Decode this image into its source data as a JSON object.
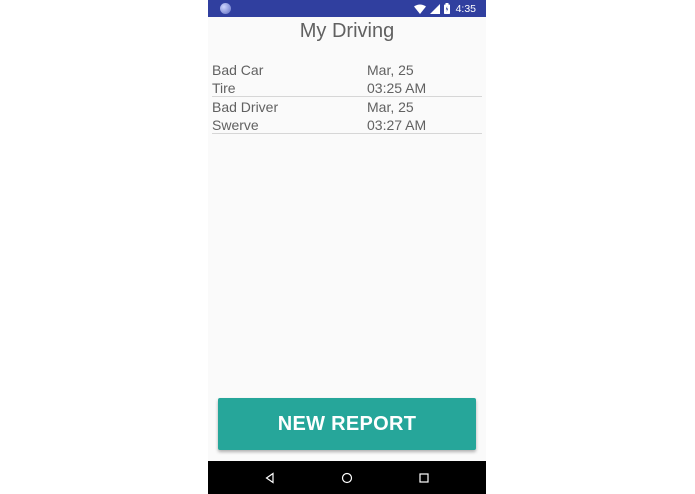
{
  "status_bar": {
    "time": "4:35"
  },
  "header": {
    "title": "My Driving"
  },
  "reports": [
    {
      "type": "Bad Car",
      "subtype": "Tire",
      "date": "Mar, 25",
      "time": "03:25 AM"
    },
    {
      "type": "Bad Driver",
      "subtype": "Swerve",
      "date": "Mar, 25",
      "time": "03:27 AM"
    }
  ],
  "actions": {
    "new_report_label": "NEW REPORT"
  },
  "colors": {
    "status_bar": "#303f9f",
    "accent": "#26a69a",
    "background": "#fafafa",
    "text": "#616161"
  }
}
